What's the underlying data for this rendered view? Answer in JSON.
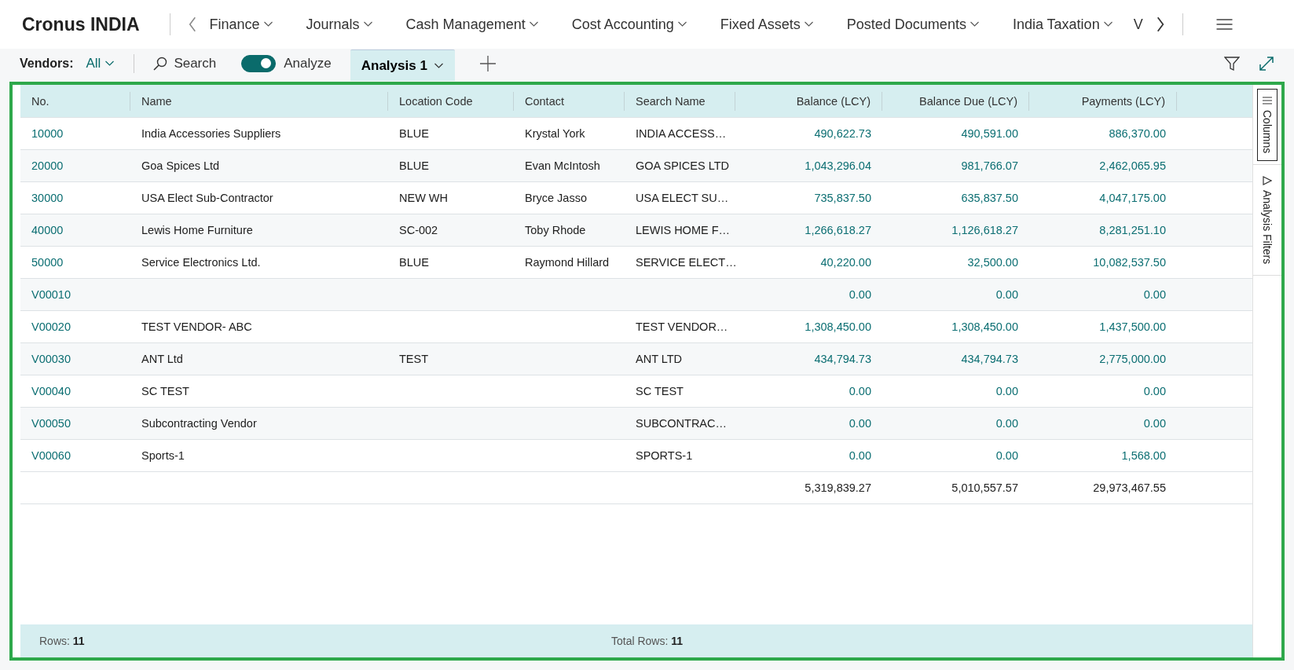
{
  "app": {
    "title": "Cronus INDIA"
  },
  "nav": {
    "items": [
      "Finance",
      "Journals",
      "Cash Management",
      "Cost Accounting",
      "Fixed Assets",
      "Posted Documents",
      "India Taxation"
    ],
    "overflow_item": "V"
  },
  "toolbar": {
    "label": "Vendors:",
    "filter": "All",
    "search": "Search",
    "analyze": {
      "label": "Analyze",
      "on": true
    },
    "tabs": [
      {
        "label": "Analysis 1",
        "selected": true
      }
    ]
  },
  "table": {
    "columns": [
      "No.",
      "Name",
      "Location Code",
      "Contact",
      "Search Name",
      "Balance (LCY)",
      "Balance Due (LCY)",
      "Payments (LCY)"
    ],
    "rows": [
      [
        "10000",
        "India Accessories Suppliers",
        "BLUE",
        "Krystal York",
        "INDIA ACCESS…",
        "490,622.73",
        "490,591.00",
        "886,370.00"
      ],
      [
        "20000",
        "Goa Spices Ltd",
        "BLUE",
        "Evan McIntosh",
        "GOA SPICES LTD",
        "1,043,296.04",
        "981,766.07",
        "2,462,065.95"
      ],
      [
        "30000",
        "USA Elect Sub-Contractor",
        "NEW WH",
        "Bryce Jasso",
        "USA ELECT SU…",
        "735,837.50",
        "635,837.50",
        "4,047,175.00"
      ],
      [
        "40000",
        "Lewis Home Furniture",
        "SC-002",
        "Toby Rhode",
        "LEWIS HOME F…",
        "1,266,618.27",
        "1,126,618.27",
        "8,281,251.10"
      ],
      [
        "50000",
        "Service Electronics Ltd.",
        "BLUE",
        "Raymond Hillard",
        "SERVICE ELECT…",
        "40,220.00",
        "32,500.00",
        "10,082,537.50"
      ],
      [
        "V00010",
        "",
        "",
        "",
        "",
        "0.00",
        "0.00",
        "0.00"
      ],
      [
        "V00020",
        "TEST VENDOR- ABC",
        "",
        "",
        "TEST VENDOR…",
        "1,308,450.00",
        "1,308,450.00",
        "1,437,500.00"
      ],
      [
        "V00030",
        "ANT Ltd",
        "TEST",
        "",
        "ANT LTD",
        "434,794.73",
        "434,794.73",
        "2,775,000.00"
      ],
      [
        "V00040",
        "SC TEST",
        "",
        "",
        "SC TEST",
        "0.00",
        "0.00",
        "0.00"
      ],
      [
        "V00050",
        "Subcontracting Vendor",
        "",
        "",
        "SUBCONTRAC…",
        "0.00",
        "0.00",
        "0.00"
      ],
      [
        "V00060",
        "Sports-1",
        "",
        "",
        "SPORTS-1",
        "0.00",
        "0.00",
        "1,568.00"
      ]
    ],
    "totals": [
      "5,319,839.27",
      "5,010,557.57",
      "29,973,467.55"
    ]
  },
  "side_panel": [
    "Columns",
    "Analysis Filters"
  ],
  "footer": {
    "rows_label": "Rows:",
    "rows": "11",
    "total_label": "Total Rows:",
    "total": "11"
  }
}
